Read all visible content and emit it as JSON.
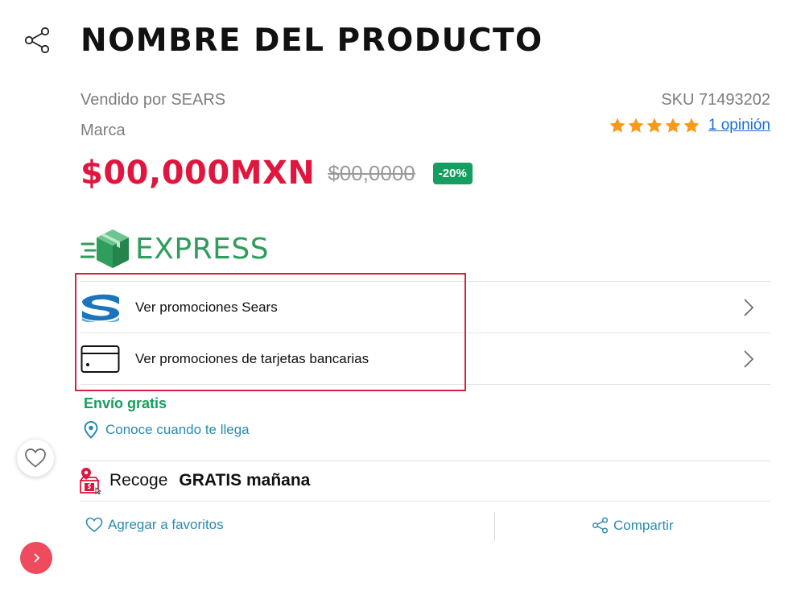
{
  "product": {
    "title": "NOMBRE DEL PRODUCTO",
    "seller": "Vendido por SEARS",
    "brand": "Marca",
    "sku": "SKU 71493202",
    "rating": {
      "stars": 5,
      "max": 5,
      "reviews_label": "1 opinión"
    },
    "price": "$00,000MXN",
    "price_old": "$00,0000",
    "discount": "-20%"
  },
  "express": {
    "label": "EXPRESS"
  },
  "promos": [
    {
      "label": "Ver promociones Sears",
      "icon": "sears-logo-icon"
    },
    {
      "label": "Ver promociones de tarjetas bancarias",
      "icon": "credit-card-icon"
    }
  ],
  "shipping": {
    "free_label": "Envío gratis",
    "know_label": "Conoce cuando te llega"
  },
  "pickup": {
    "label": "Recoge",
    "strong": "GRATIS mañana"
  },
  "actions": {
    "favorites": "Agregar a favoritos",
    "share": "Compartir"
  },
  "colors": {
    "price": "#e0163f",
    "accent_green": "#149e5f",
    "link_blue": "#1a6fd1",
    "action_teal": "#2a8bb0",
    "star": "#f79a1b",
    "highlight_border": "#d4243e",
    "next_button": "#ee4b5f"
  }
}
